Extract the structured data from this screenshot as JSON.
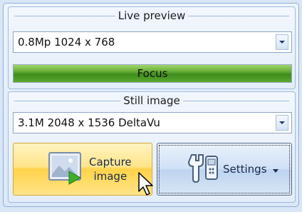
{
  "live_preview": {
    "title": "Live preview",
    "resolution": "0.8Mp 1024 x 768",
    "focus_label": "Focus",
    "focus_level": 1.0
  },
  "still_image": {
    "title": "Still image",
    "resolution": "3.1M 2048 x 1536 DeltaVu",
    "capture_line1": "Capture",
    "capture_line2": "image",
    "settings_label": "Settings"
  },
  "icons": {
    "capture": "picture-with-play-icon",
    "settings": "wrench-phone-icon",
    "dropdown": "chevron-down-icon",
    "cursor": "mouse-pointer-icon"
  },
  "colors": {
    "panel_bg": "#dae7f6",
    "group_border": "#9ebbdf",
    "focus_green": "#4a991f",
    "capture_yellow": "#ffd34a",
    "settings_blue": "#bdd3ef"
  }
}
